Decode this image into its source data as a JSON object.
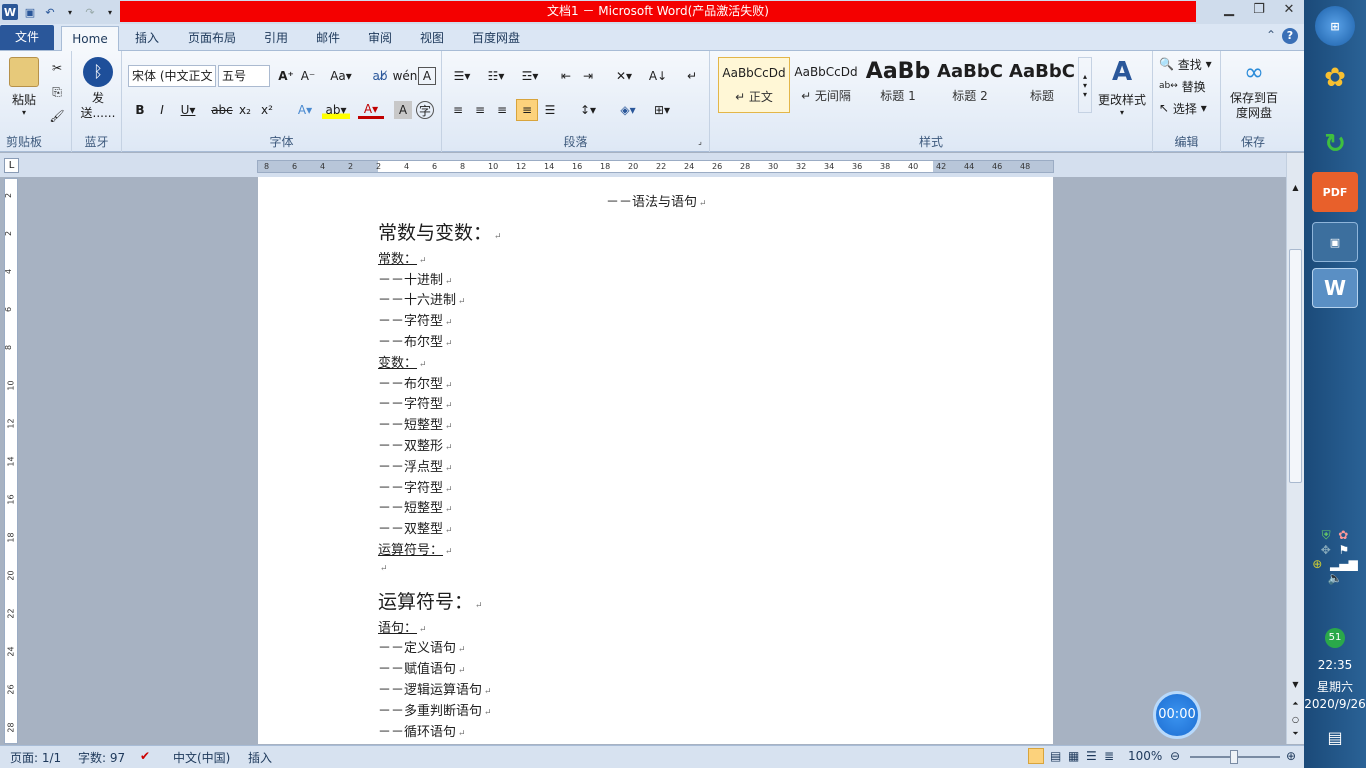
{
  "window": {
    "title": "文档1 － Microsoft Word(产品激活失败)",
    "qat_icons": [
      "word-icon",
      "save-icon",
      "undo-icon",
      "redo-icon",
      "customize-icon"
    ]
  },
  "tabs": [
    {
      "label": "文件",
      "name": "tab-file"
    },
    {
      "label": "Home",
      "name": "tab-home"
    },
    {
      "label": "插入",
      "name": "tab-insert"
    },
    {
      "label": "页面布局",
      "name": "tab-page-layout"
    },
    {
      "label": "引用",
      "name": "tab-references"
    },
    {
      "label": "邮件",
      "name": "tab-mailings"
    },
    {
      "label": "审阅",
      "name": "tab-review"
    },
    {
      "label": "视图",
      "name": "tab-view"
    },
    {
      "label": "百度网盘",
      "name": "tab-baidu"
    }
  ],
  "ribbon": {
    "clipboard": {
      "group": "剪贴板",
      "paste": "粘贴"
    },
    "bluetooth": {
      "group": "蓝牙",
      "send": "发送......"
    },
    "font": {
      "group": "字体",
      "family": "宋体 (中文正文",
      "size": "五号"
    },
    "paragraph": {
      "group": "段落"
    },
    "styles": {
      "group": "样式",
      "items": [
        {
          "sample": "AaBbCcDd",
          "name": "↵ 正文"
        },
        {
          "sample": "AaBbCcDd",
          "name": "↵ 无间隔"
        },
        {
          "sample": "AaBb",
          "name": "标题 1"
        },
        {
          "sample": "AaBbC",
          "name": "标题 2"
        },
        {
          "sample": "AaBbC",
          "name": "标题"
        }
      ],
      "change": "更改样式"
    },
    "editing": {
      "group": "编辑",
      "find": "查找",
      "replace": "替换",
      "select": "选择"
    },
    "save": {
      "group": "保存",
      "baidu": "保存到百度网盘"
    }
  },
  "ruler": {
    "numbers": [
      "8",
      "6",
      "4",
      "2",
      "2",
      "4",
      "6",
      "8",
      "10",
      "12",
      "14",
      "16",
      "18",
      "20",
      "22",
      "24",
      "26",
      "28",
      "30",
      "32",
      "34",
      "36",
      "38",
      "40",
      "42",
      "44",
      "46",
      "48"
    ],
    "vnumbers": [
      "2",
      "2",
      "4",
      "6",
      "8",
      "10",
      "12",
      "14",
      "16",
      "18",
      "20",
      "22",
      "24",
      "26",
      "28"
    ]
  },
  "document": {
    "lines": [
      {
        "text": "－－语法与语句",
        "style": "center"
      },
      {
        "text": "常数与变数：",
        "style": "head"
      },
      {
        "text": "常数：",
        "style": "u"
      },
      {
        "text": "－－十进制",
        "style": ""
      },
      {
        "text": "－－十六进制",
        "style": ""
      },
      {
        "text": "－－字符型",
        "style": ""
      },
      {
        "text": "－－布尔型",
        "style": ""
      },
      {
        "text": "变数：",
        "style": "u"
      },
      {
        "text": "－－布尔型",
        "style": ""
      },
      {
        "text": "－－字符型",
        "style": ""
      },
      {
        "text": "－－短整型",
        "style": ""
      },
      {
        "text": "－－双整形",
        "style": ""
      },
      {
        "text": "－－浮点型",
        "style": ""
      },
      {
        "text": "－－字符型",
        "style": ""
      },
      {
        "text": "－－短整型",
        "style": ""
      },
      {
        "text": "－－双整型",
        "style": ""
      },
      {
        "text": "运算符号：",
        "style": "u"
      },
      {
        "text": "",
        "style": ""
      },
      {
        "text": "运算符号：",
        "style": "head"
      },
      {
        "text": "语句：",
        "style": "u"
      },
      {
        "text": "－－定义语句",
        "style": ""
      },
      {
        "text": "－－赋值语句",
        "style": ""
      },
      {
        "text": "－－逻辑运算语句",
        "style": ""
      },
      {
        "text": "－－多重判断语句",
        "style": ""
      },
      {
        "text": "－－循环语句",
        "style": ""
      }
    ],
    "para_mark": "↵"
  },
  "statusbar": {
    "page": "页面: 1/1",
    "words": "字数: 97",
    "language": "中文(中国)",
    "mode": "插入",
    "zoom": "100%"
  },
  "timer": "00:00",
  "taskbar": {
    "time": "22:35",
    "weekday": "星期六",
    "date": "2020/9/26",
    "badge": "51"
  }
}
